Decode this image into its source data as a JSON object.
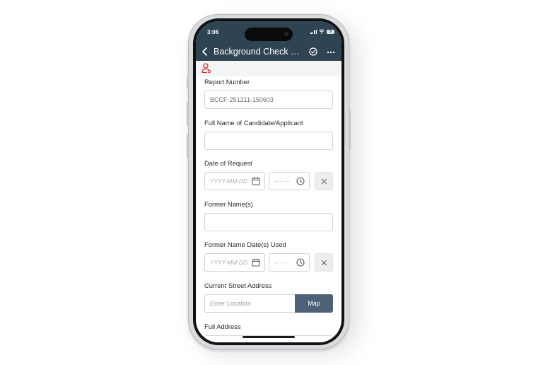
{
  "status_bar": {
    "time": "3:06",
    "battery": "5"
  },
  "header": {
    "title": "Background Check Co...",
    "icons": {
      "back": "chevron-left-icon",
      "save": "check-circle-icon",
      "more": "more-horizontal-icon"
    }
  },
  "subbar": {
    "icon": "user-icon",
    "icon_color": "#d32f2f"
  },
  "form": {
    "report_number": {
      "label": "Report Number",
      "value": "BCCF-251211-150603"
    },
    "full_name": {
      "label": "Full Name of Candidate/Applicant",
      "value": ""
    },
    "date_of_request": {
      "label": "Date of Request",
      "date_placeholder": "YYYY-MM-DD",
      "time_placeholder": "--:-- --"
    },
    "former_names": {
      "label": "Former Name(s)",
      "value": ""
    },
    "former_name_dates": {
      "label": "Former Name Date(s) Used",
      "date_placeholder": "YYYY-MM-DD",
      "time_placeholder": "--:-- --"
    },
    "current_street_address": {
      "label": "Current Street Address",
      "placeholder": "Enter Location",
      "map_button": "Map"
    },
    "full_address": {
      "label": "Full Address"
    }
  },
  "colors": {
    "header_bg": "#2f4452",
    "map_button_bg": "#4d6277"
  }
}
